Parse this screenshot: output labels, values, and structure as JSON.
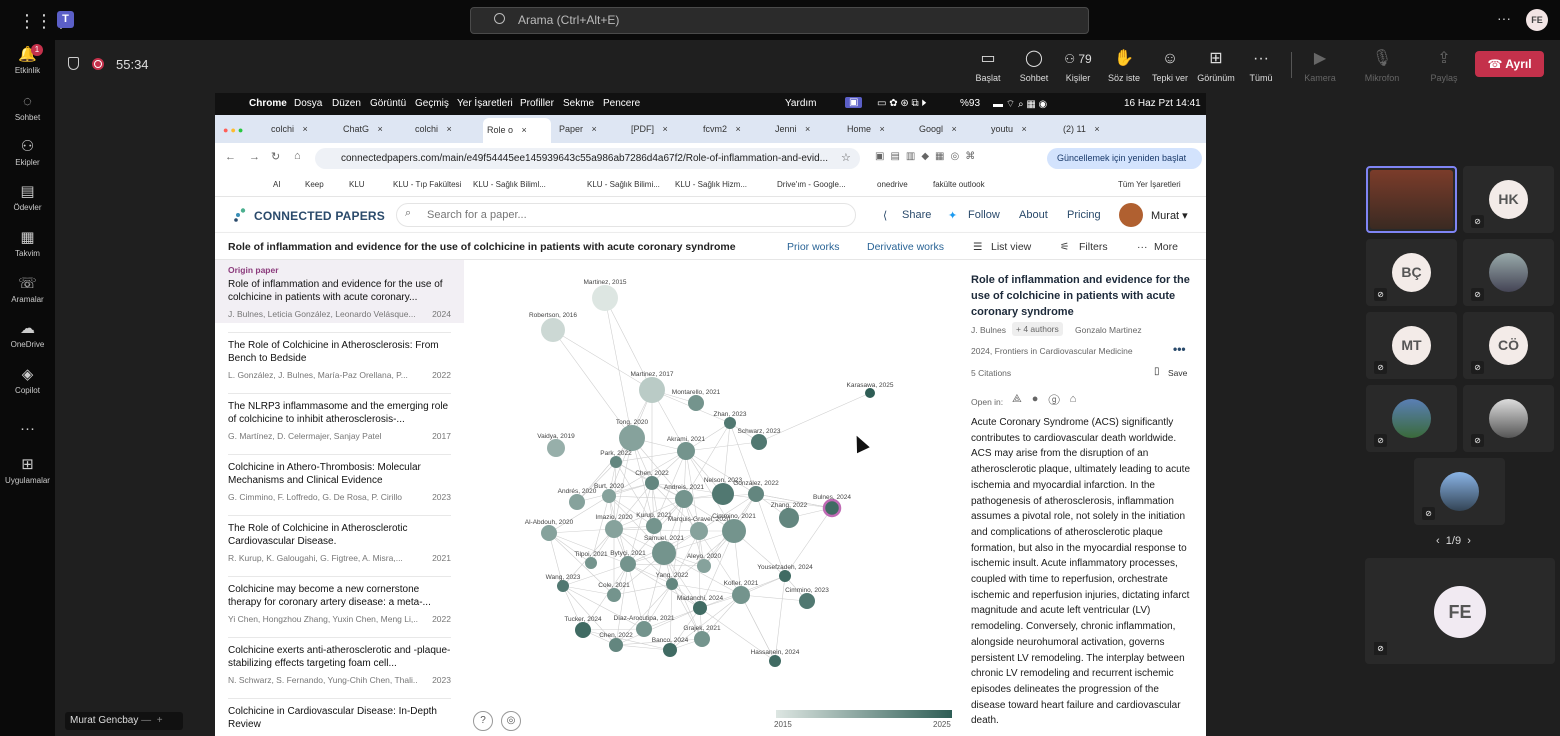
{
  "teams": {
    "search_placeholder": "Arama (Ctrl+Alt+E)",
    "avatar": "FE",
    "timer": "55:34",
    "rail": [
      {
        "icon": "bell-icon",
        "label": "Etkinlik",
        "badge": "1"
      },
      {
        "icon": "chat-icon",
        "label": "Sohbet"
      },
      {
        "icon": "teams-icon",
        "label": "Ekipler"
      },
      {
        "icon": "assignment-icon",
        "label": "Ödevler"
      },
      {
        "icon": "calendar-icon",
        "label": "Takvim"
      },
      {
        "icon": "phone-icon",
        "label": "Aramalar"
      },
      {
        "icon": "cloud-icon",
        "label": "OneDrive"
      },
      {
        "icon": "copilot-icon",
        "label": "Copilot"
      },
      {
        "icon": "more-icon",
        "label": ""
      },
      {
        "icon": "plus-icon",
        "label": "Uygulamalar"
      }
    ],
    "controls": [
      {
        "icon": "share-icon",
        "label": "Başlat",
        "glyph": "▭"
      },
      {
        "icon": "chat-icon",
        "label": "Sohbet",
        "glyph": "◯"
      },
      {
        "icon": "people-icon",
        "label": "Kişiler",
        "glyph": "⚇ 79"
      },
      {
        "icon": "raise-hand-icon",
        "label": "Söz iste",
        "glyph": "✋"
      },
      {
        "icon": "react-icon",
        "label": "Tepki ver",
        "glyph": "☺"
      },
      {
        "icon": "view-icon",
        "label": "Görünüm",
        "glyph": "⊞"
      },
      {
        "icon": "more-icon",
        "label": "Tümü",
        "glyph": "···"
      },
      {
        "icon": "camera-icon",
        "label": "Kamera",
        "glyph": "▶"
      },
      {
        "icon": "mic-icon",
        "label": "Mikrofon",
        "glyph": "🎙"
      },
      {
        "icon": "share-tray-icon",
        "label": "Paylaş",
        "glyph": "⇪"
      }
    ],
    "leave_label": "Ayrıl",
    "name_tag": "Murat Gencbay",
    "pager": "1/9",
    "participants": [
      "",
      "HK",
      "BÇ",
      "",
      "MT",
      "CÖ",
      "",
      "",
      "",
      ""
    ],
    "fe": "FE"
  },
  "mac": {
    "menus": [
      "Chrome",
      "Dosya",
      "Düzen",
      "Görüntü",
      "Geçmiş",
      "Yer İşaretleri",
      "Profiller",
      "Sekme",
      "Pencere",
      "Yardım"
    ],
    "status": "%93",
    "datetime": "16 Haz Pzt 14:41"
  },
  "browser": {
    "tabs": [
      "colchi",
      "ChatG",
      "colchi",
      "Role o",
      "Paper",
      "[PDF]",
      "fcvm2",
      "Jenni",
      "Home",
      "Googl",
      "youtu",
      "(2) 11"
    ],
    "url": "connectedpapers.com/main/e49f54445ee145939643c55a986ab7286d4a67f2/Role-of-inflammation-and-evid...",
    "update_label": "Güncellemek için yeniden başlat",
    "bookmarks": [
      "AI",
      "Keep",
      "KLU",
      "KLU - Tıp Fakültesi",
      "KLU - Sağlık Biliml...",
      "KLU - Sağlık Bilimi...",
      "KLU - Sağlık Hizm...",
      "Drive'ım - Google...",
      "onedrive",
      "fakülte outlook",
      "Tüm Yer İşaretleri"
    ]
  },
  "cp": {
    "logo": "CONNECTED PAPERS",
    "search_placeholder": "Search for a paper...",
    "nav": [
      "Share",
      "Follow",
      "About",
      "Pricing",
      "Murat"
    ],
    "paper_title": "Role of inflammation and evidence for the use of colchicine in patients with acute coronary syndrome",
    "subnav": [
      "Prior works",
      "Derivative works",
      "List view",
      "Filters",
      "More"
    ],
    "origin_label": "Origin paper",
    "list": [
      {
        "title": "Role of inflammation and evidence for the use of colchicine in patients with acute coronary...",
        "authors": "J. Bulnes, Leticia González, Leonardo Velásque...",
        "year": "2024"
      },
      {
        "title": "The Role of Colchicine in Atherosclerosis: From Bench to Bedside",
        "authors": "L. González, J. Bulnes, María-Paz Orellana, P...",
        "year": "2022"
      },
      {
        "title": "The NLRP3 inflammasome and the emerging role of colchicine to inhibit atherosclerosis-...",
        "authors": "G. Martínez, D. Celermajer, Sanjay Patel",
        "year": "2017"
      },
      {
        "title": "Colchicine in Athero-Thrombosis: Molecular Mechanisms and Clinical Evidence",
        "authors": "G. Cimmino, F. Loffredo, G. De Rosa, P. Cirillo",
        "year": "2023"
      },
      {
        "title": "The Role of Colchicine in Atherosclerotic Cardiovascular Disease.",
        "authors": "R. Kurup, K. Galougahi, G. Figtree, A. Misra,...",
        "year": "2021"
      },
      {
        "title": "Colchicine may become a new cornerstone therapy for coronary artery disease: a meta-...",
        "authors": "Yi Chen, Hongzhou Zhang, Yuxin Chen, Meng Li,...",
        "year": "2022"
      },
      {
        "title": "Colchicine exerts anti-atherosclerotic and -plaque-stabilizing effects targeting foam cell...",
        "authors": "N. Schwarz, S. Fernando, Yung-Chih Chen, Thali...",
        "year": "2023"
      },
      {
        "title": "Colchicine in Cardiovascular Disease: In-Depth Review",
        "authors": "",
        "year": ""
      }
    ],
    "graph_nodes": [
      {
        "label": "Martinez, 2015",
        "year": 2015,
        "size": 13
      },
      {
        "label": "Robertson, 2016",
        "year": 2016,
        "size": 12
      },
      {
        "label": "Martinez, 2017",
        "year": 2017,
        "size": 13
      },
      {
        "label": "Montarello, 2021",
        "year": 2021,
        "size": 8
      },
      {
        "label": "Karasawa, 2025",
        "year": 2025,
        "size": 5
      },
      {
        "label": "Zhan, 2023",
        "year": 2023,
        "size": 6
      },
      {
        "label": "Vaidya, 2019",
        "year": 2019,
        "size": 9
      },
      {
        "label": "Tong, 2020",
        "year": 2020,
        "size": 13
      },
      {
        "label": "Akrami, 2021",
        "year": 2021,
        "size": 9
      },
      {
        "label": "Schwarz, 2023",
        "year": 2023,
        "size": 8
      },
      {
        "label": "Park, 2022",
        "year": 2022,
        "size": 6
      },
      {
        "label": "Chen, 2022",
        "year": 2022,
        "size": 7
      },
      {
        "label": "Andrés, 2020",
        "year": 2020,
        "size": 8
      },
      {
        "label": "Burt, 2020",
        "year": 2020,
        "size": 7
      },
      {
        "label": "Andreis, 2021",
        "year": 2021,
        "size": 9
      },
      {
        "label": "Nelson, 2023",
        "year": 2023,
        "size": 11
      },
      {
        "label": "González, 2022",
        "year": 2022,
        "size": 8
      },
      {
        "label": "Bulnes, 2024",
        "year": 2024,
        "size": 8
      },
      {
        "label": "Zhang, 2022",
        "year": 2022,
        "size": 10
      },
      {
        "label": "Al-Abdouh, 2020",
        "year": 2020,
        "size": 8
      },
      {
        "label": "Imazio, 2020",
        "year": 2020,
        "size": 9
      },
      {
        "label": "Kurup, 2021",
        "year": 2021,
        "size": 8
      },
      {
        "label": "Marquis-Gravel, 2020",
        "year": 2020,
        "size": 9
      },
      {
        "label": "Cimmino, 2021",
        "year": 2021,
        "size": 12
      },
      {
        "label": "Tilpoi, 2021",
        "year": 2021,
        "size": 6
      },
      {
        "label": "Bytyçi, 2021",
        "year": 2021,
        "size": 8
      },
      {
        "label": "Samuel, 2021",
        "year": 2021,
        "size": 12
      },
      {
        "label": "Aleyo, 2020",
        "year": 2020,
        "size": 7
      },
      {
        "label": "Wang, 2023",
        "year": 2023,
        "size": 6
      },
      {
        "label": "Yang, 2022",
        "year": 2022,
        "size": 6
      },
      {
        "label": "Cole, 2021",
        "year": 2021,
        "size": 7
      },
      {
        "label": "Kofler, 2021",
        "year": 2021,
        "size": 9
      },
      {
        "label": "Yousefzadeh, 2024",
        "year": 2024,
        "size": 6
      },
      {
        "label": "Cimmino, 2023",
        "year": 2023,
        "size": 8
      },
      {
        "label": "Madanchi, 2024",
        "year": 2024,
        "size": 7
      },
      {
        "label": "Tucker, 2024",
        "year": 2024,
        "size": 8
      },
      {
        "label": "Díaz-Arocutipa, 2021",
        "year": 2021,
        "size": 8
      },
      {
        "label": "Chen, 2022",
        "year": 2022,
        "size": 7
      },
      {
        "label": "Banco, 2024",
        "year": 2024,
        "size": 7
      },
      {
        "label": "Grajek, 2021",
        "year": 2021,
        "size": 8
      },
      {
        "label": "Hassanein, 2024",
        "year": 2024,
        "size": 6
      }
    ],
    "legend": {
      "min": "2015",
      "max": "2025"
    },
    "detail": {
      "title": "Role of inflammation and evidence for the use of colchicine in patients with acute coronary syndrome",
      "author1": "J. Bulnes",
      "more_authors": "+ 4 authors",
      "author2": "Gonzalo Martinez",
      "journal": "2024, Frontiers in Cardiovascular Medicine",
      "citations": "5 Citations",
      "save": "Save",
      "open_in": "Open in:",
      "abstract": "Acute Coronary Syndrome (ACS) significantly contributes to cardiovascular death worldwide. ACS may arise from the disruption of an atherosclerotic plaque, ultimately leading to acute ischemia and myocardial infarction. In the pathogenesis of atherosclerosis, inflammation assumes a pivotal role, not solely in the initiation and complications of atherosclerotic plaque formation, but also in the myocardial response to ischemic insult. Acute inflammatory processes, coupled with time to reperfusion, orchestrate ischemic and reperfusion injuries, dictating infarct magnitude and acute left ventricular (LV) remodeling. Conversely, chronic inflammation, alongside neurohumoral activation, governs persistent LV remodeling. The interplay between chronic LV remodeling and recurrent ischemic episodes delineates the progression of the disease toward heart failure and cardiovascular death."
    }
  }
}
